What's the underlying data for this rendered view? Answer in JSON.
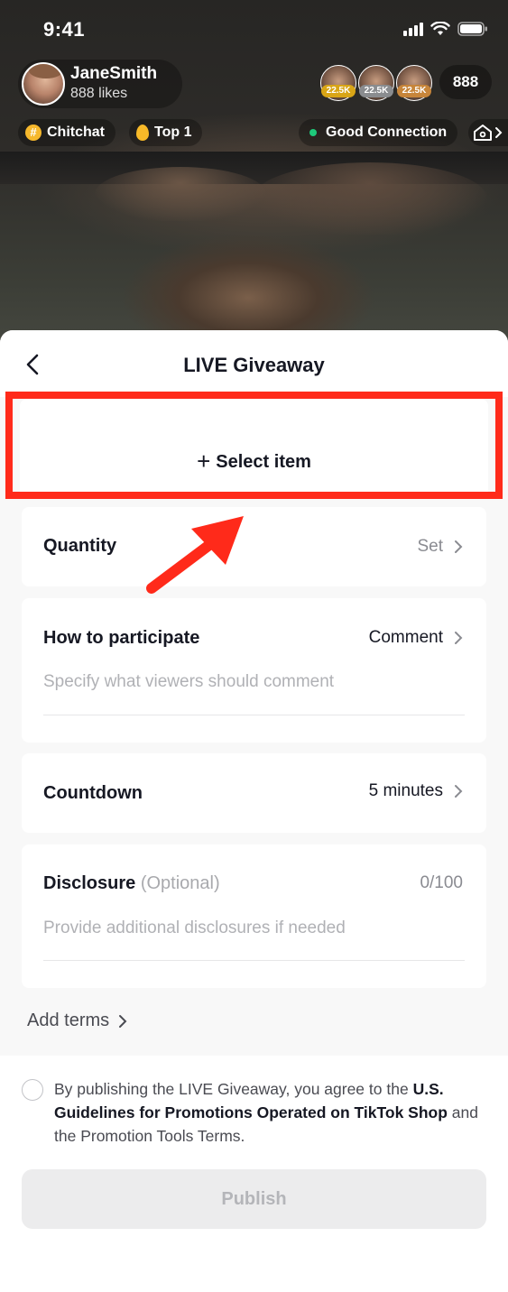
{
  "status_bar": {
    "time": "9:41"
  },
  "host": {
    "name": "JaneSmith",
    "likes": "888 likes"
  },
  "viewers": {
    "badges": [
      "22.5K",
      "22.5K",
      "22.5K"
    ],
    "count": "888"
  },
  "chips": {
    "topic": "Chitchat",
    "topic_icon": "#",
    "rank": "Top 1",
    "connection": "Good Connection"
  },
  "sheet": {
    "title": "LIVE Giveaway",
    "select_item": "Select item",
    "quantity": {
      "label": "Quantity",
      "value": "Set"
    },
    "participate": {
      "label": "How to participate",
      "value": "Comment",
      "placeholder": "Specify what viewers should comment"
    },
    "countdown": {
      "label": "Countdown",
      "value": "5 minutes"
    },
    "disclosure": {
      "label": "Disclosure",
      "optional": "(Optional)",
      "counter": "0/100",
      "placeholder": "Provide additional disclosures if needed"
    },
    "add_terms": "Add terms"
  },
  "footer": {
    "agree_prefix": "By publishing the LIVE Giveaway, you agree to the ",
    "agree_link": "U.S. Guidelines for Promotions Operated on TikTok Shop",
    "agree_suffix": " and the Promotion Tools Terms.",
    "publish": "Publish"
  },
  "colors": {
    "highlight": "#ff2a1a",
    "publish_disabled_bg": "#ececed",
    "connection_dot": "#1ec97a"
  }
}
